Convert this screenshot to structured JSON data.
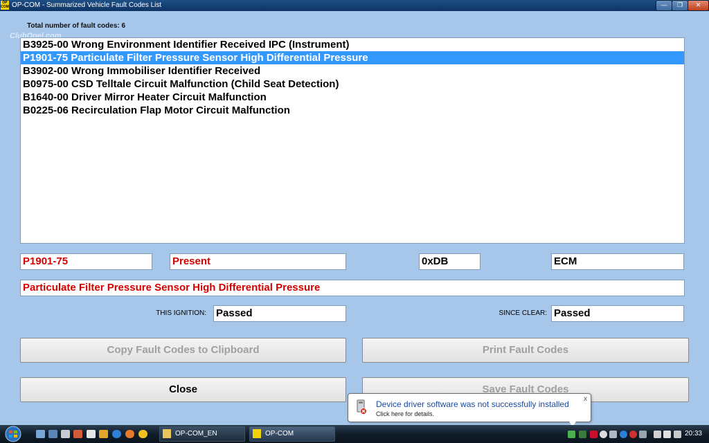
{
  "window": {
    "title": "OP-COM - Summarized Vehicle Fault Codes List",
    "app_icon_text_top": "OP",
    "app_icon_text_bottom": "COM"
  },
  "watermark": "ClubOpel.com",
  "summary": {
    "count_label": "Total number of fault codes: 6"
  },
  "fault_codes": [
    {
      "text": "B3925-00 Wrong Environment Identifier Received IPC (Instrument)",
      "selected": false
    },
    {
      "text": "P1901-75 Particulate Filter Pressure Sensor High Differential Pressure",
      "selected": true
    },
    {
      "text": "B3902-00 Wrong Immobiliser Identifier Received",
      "selected": false
    },
    {
      "text": "B0975-00 CSD Telltale Circuit Malfunction (Child Seat Detection)",
      "selected": false
    },
    {
      "text": "B1640-00 Driver Mirror Heater Circuit Malfunction",
      "selected": false
    },
    {
      "text": "B0225-06 Recirculation Flap Motor Circuit Malfunction",
      "selected": false
    }
  ],
  "detail": {
    "code": "P1901-75",
    "status": "Present",
    "hex_code": "0xDB",
    "module": "ECM",
    "description": "Particulate Filter Pressure Sensor High Differential Pressure",
    "this_ignition_label": "THIS IGNITION:",
    "this_ignition_value": "Passed",
    "since_clear_label": "SINCE CLEAR:",
    "since_clear_value": "Passed"
  },
  "buttons": {
    "copy": "Copy Fault Codes to Clipboard",
    "print": "Print Fault Codes",
    "close": "Close",
    "save": "Save Fault Codes"
  },
  "notification": {
    "title": "Device driver software was not successfully installed",
    "subtitle": "Click here for details.",
    "close": "x"
  },
  "taskbar": {
    "tasks": [
      {
        "label": "OP-COM_EN",
        "active": false
      },
      {
        "label": "OP-COM",
        "active": true
      }
    ],
    "clock": "20:33"
  },
  "colors": {
    "client_bg": "#a7c7ea",
    "selection": "#3399ff",
    "detail_red": "#d50000"
  }
}
